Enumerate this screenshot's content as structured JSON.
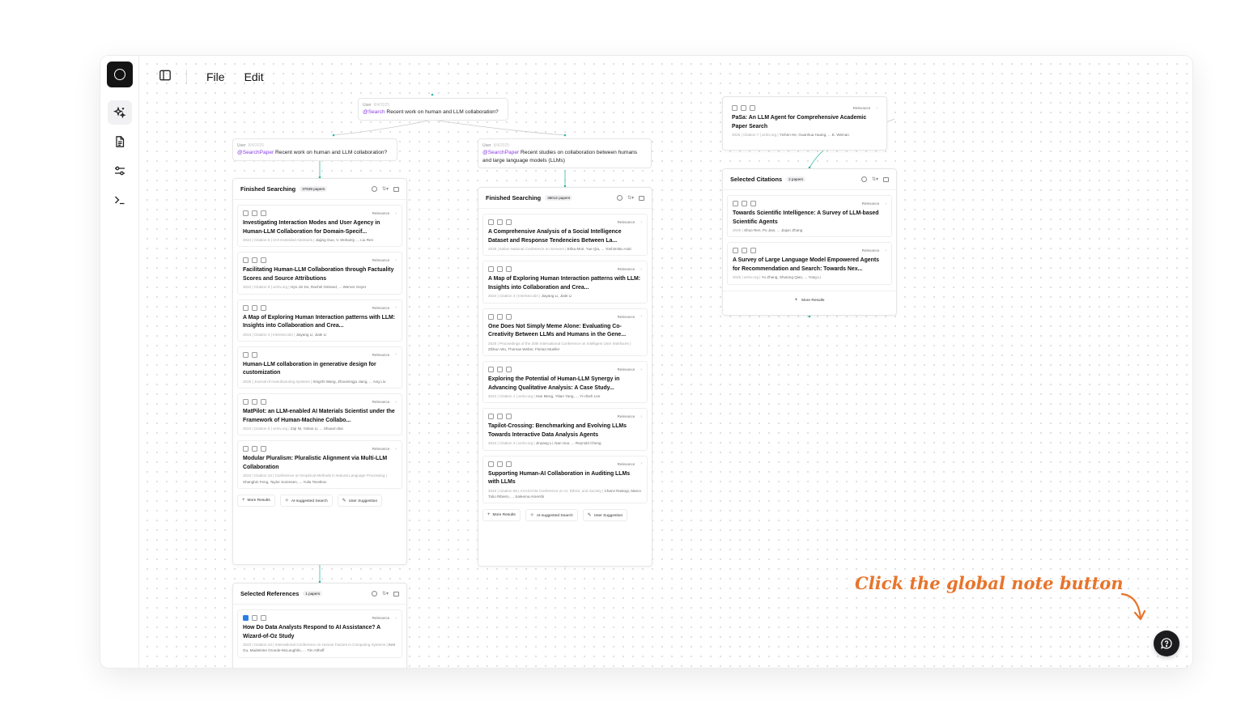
{
  "app": {
    "menu": [
      "File",
      "Edit"
    ],
    "rail_icons": [
      "sparkles-icon",
      "document-icon",
      "sliders-icon",
      "terminal-icon"
    ]
  },
  "queries": [
    {
      "user": "User",
      "time": "8/4/2025",
      "tag": "@Search",
      "text": " Recent work on human and LLM collaboration?"
    },
    {
      "user": "User",
      "time": "8/4/2025",
      "tag": "@SearchPaper",
      "text": " Recent work on human and LLM collaboration?"
    },
    {
      "user": "User",
      "time": "8/4/2025",
      "tag": "@SearchPaper",
      "text": " Recent studies on collaboration between humans and large language models (LLMs)"
    }
  ],
  "panels": {
    "left": {
      "title": "Finished Searching",
      "count": "37939 papers",
      "relevance": "Relevance",
      "cards": [
        {
          "title": "Investigating Interaction Modes and User Agency in Human-LLM Collaboration for Domain-Specif...",
          "meta": "2024 | Citation 6 | CHI Extended Abstracts | ",
          "authors": "Jiajing Guo, V. Mohanty, ... Liu Ren"
        },
        {
          "title": "Facilitating Human-LLM Collaboration through Factuality Scores and Source Attributions",
          "meta": "2024 | Citation 8 | arXiv.org | ",
          "authors": "Hyo Jin Do, Rachel Ostrand, ... Werner Geyer"
        },
        {
          "title": "A Map of Exploring Human Interaction patterns with LLM: Insights into Collaboration and Crea...",
          "meta": "2024 | Citation 4 | Intersección | ",
          "authors": "Jiayang Li, Jiale Li"
        },
        {
          "title": "Human-LLM collaboration in generative design for customization",
          "meta": "2025 | Journal of manufacturing systems | ",
          "authors": "Xingzhi Wang, Zhoumingju Jiang, ... Ang Liu"
        },
        {
          "title": "MatPilot: an LLM-enabled AI Materials Scientist under the Framework of Human-Machine Collabo...",
          "meta": "2024 | Citation 5 | arXiv.org | ",
          "authors": "Ziqi Ni, Yahao Li, ... Shuaon Bai"
        },
        {
          "title": "Modular Pluralism: Pluralistic Alignment via Multi-LLM Collaboration",
          "meta": "2024 | Citation 24 | Conference on Empirical Methods in Natural Language Processing | ",
          "authors": "Shangbin Feng, Taylor Sorensen, ... Yulia Tsvetkov"
        }
      ],
      "footer": [
        "More Results",
        "AI-suggested Search",
        "User Suggestion"
      ]
    },
    "middle": {
      "title": "Finished Searching",
      "count": "36012 papers",
      "relevance": "Relevance",
      "cards": [
        {
          "title": "A Comprehensive Analysis of a Social Intelligence Dataset and Response Tendencies Between La...",
          "meta": "2025 | Italian National Conference on Sensors | ",
          "authors": "Erika Mori, Yue Qiu, ... Yoshimitsu Aoki"
        },
        {
          "title": "A Map of Exploring Human Interaction patterns with LLM: Insights into Collaboration and Crea...",
          "meta": "2024 | Citation 4 | Intersección | ",
          "authors": "Jiayang Li, Jiale Li"
        },
        {
          "title": "One Does Not Simply Meme Alone: Evaluating Co-Creativity Between LLMs and Humans in the Gene...",
          "meta": "2025 | Proceedings of the 30th International Conference on Intelligent User Interfaces | ",
          "authors": "Zhikun Wu, Thomas Weber, Florian Mueller"
        },
        {
          "title": "Exploring the Potential of Human-LLM Synergy in Advancing Qualitative Analysis: A Case Study...",
          "meta": "2024 | Citation 1 | arXiv.org | ",
          "authors": "Han Meng, Yitian Yang, ... Yi-chieh Lee"
        },
        {
          "title": "Tapilot-Crossing: Benchmarking and Evolving LLMs Towards Interactive Data Analysis Agents",
          "meta": "2024 | Citation 3 | arXiv.org | ",
          "authors": "Jinyang Li, Nan Huo, ... Reynold Cheng"
        },
        {
          "title": "Supporting Human-AI Collaboration in Auditing LLMs with LLMs",
          "meta": "2023 | Citation 58 | AAAI/ACM Conference on AI, Ethics, and Society | ",
          "authors": "Charvi Rastogi, Marco Tulio Ribeiro, ... Saleema Amershi"
        }
      ],
      "footer": [
        "More Results",
        "AI-suggested Search",
        "User Suggestion"
      ]
    },
    "references": {
      "title": "Selected References",
      "count": "1 papers",
      "relevance": "Relevance",
      "cards": [
        {
          "title": "How Do Data Analysts Respond to AI Assistance? A Wizard-of-Oz Study",
          "meta": "2023 | Citation 24 | International Conference on Human Factors in Computing Systems | ",
          "authors": "Ken Gu, Madeleine Grunde-McLaughlin, ... Tim Althoff"
        }
      ]
    },
    "pasa": {
      "relevance": "Relevance",
      "title": "PaSa: An LLM Agent for Comprehensive Academic Paper Search",
      "meta": "2025 | Citation 7 | arXiv.org | ",
      "authors": "Yichen He, Guanhua Huang, ... E. Weinan"
    },
    "citations": {
      "title": "Selected Citations",
      "count": "2 papers",
      "relevance": "Relevance",
      "cards": [
        {
          "title": "Towards Scientific Intelligence: A Survey of LLM-based Scientific Agents",
          "meta": "2025 | ",
          "authors": "Shuo Ren, Pu Jian, ... Jiajun Zhang"
        },
        {
          "title": "A Survey of Large Language Model Empowered Agents for Recommendation and Search: Towards Nex...",
          "meta": "2025 | arXiv.org | ",
          "authors": "Yu Zhang, Shutong Qiao, ... Yong Li"
        }
      ],
      "more": "More Results"
    }
  },
  "annotation": {
    "text": "Click the global note button",
    "color": "#e8742b"
  },
  "colors": {
    "tag": "#8a3ee6",
    "connector": "#2fb9a4",
    "accent_icon": "#2b7de9"
  }
}
